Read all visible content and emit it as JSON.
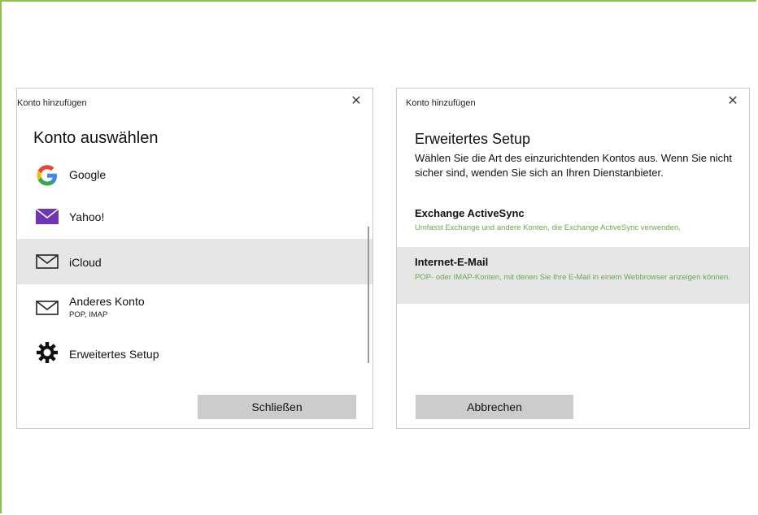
{
  "dialog_left": {
    "title": "Konto hinzufügen",
    "close_glyph": "✕",
    "heading": "Konto auswählen",
    "accounts": [
      {
        "label": "Google",
        "icon": "google-icon"
      },
      {
        "label": "Yahoo!",
        "icon": "yahoo-mail-icon"
      },
      {
        "label": "iCloud",
        "icon": "mail-icon",
        "selected": true
      },
      {
        "label": "Anderes Konto",
        "sublabel": "POP, IMAP",
        "icon": "mail-icon"
      },
      {
        "label": "Erweitertes Setup",
        "icon": "gear-icon"
      }
    ],
    "close_button": "Schließen"
  },
  "dialog_right": {
    "title": "Konto hinzufügen",
    "close_glyph": "✕",
    "heading": "Erweitertes Setup",
    "description": "Wählen Sie die Art des einzurichtenden Kontos aus. Wenn Sie nicht sicher sind, wenden Sie sich an Ihren Dienstanbieter.",
    "options": [
      {
        "title": "Exchange ActiveSync",
        "description": "Umfasst Exchange und andere Konten, die Exchange ActiveSync verwenden."
      },
      {
        "title": "Internet-E-Mail",
        "description": "POP- oder IMAP-Konten, mit denen Sie Ihre E-Mail in einem Webbrowser anzeigen können.",
        "selected": true
      }
    ],
    "cancel_button": "Abbrechen"
  },
  "colors": {
    "frame_border": "#8cc152",
    "option_description": "#6aa84f",
    "selected_row": "#e6e6e6",
    "yahoo_purple": "#6f35b5"
  }
}
